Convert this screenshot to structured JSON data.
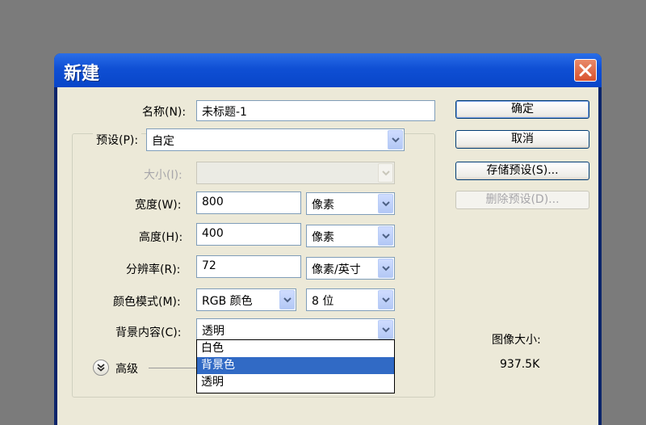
{
  "window": {
    "title": "新建"
  },
  "form": {
    "name_label": "名称(N):",
    "name_value": "未标题-1",
    "preset_label": "预设(P):",
    "preset_value": "自定",
    "size_label": "大小(I):",
    "size_value": "",
    "width_label": "宽度(W):",
    "width_value": "800",
    "width_unit": "像素",
    "height_label": "高度(H):",
    "height_value": "400",
    "height_unit": "像素",
    "resolution_label": "分辨率(R):",
    "resolution_value": "72",
    "resolution_unit": "像素/英寸",
    "color_mode_label": "颜色模式(M):",
    "color_mode_value": "RGB 颜色",
    "bit_depth_value": "8 位",
    "background_label": "背景内容(C):",
    "background_value": "透明",
    "background_options": [
      "白色",
      "背景色",
      "透明"
    ],
    "background_highlighted": "背景色",
    "advanced_label": "高级"
  },
  "buttons": {
    "ok": "确定",
    "cancel": "取消",
    "save_preset": "存储预设(S)...",
    "delete_preset": "删除预设(D)..."
  },
  "info": {
    "image_size_label": "图像大小:",
    "image_size_value": "937.5K"
  },
  "colors": {
    "titlebar": "#0f4fd4",
    "client": "#ece9d8",
    "selection": "#316ac5",
    "backdrop": "#7b7b7b"
  }
}
